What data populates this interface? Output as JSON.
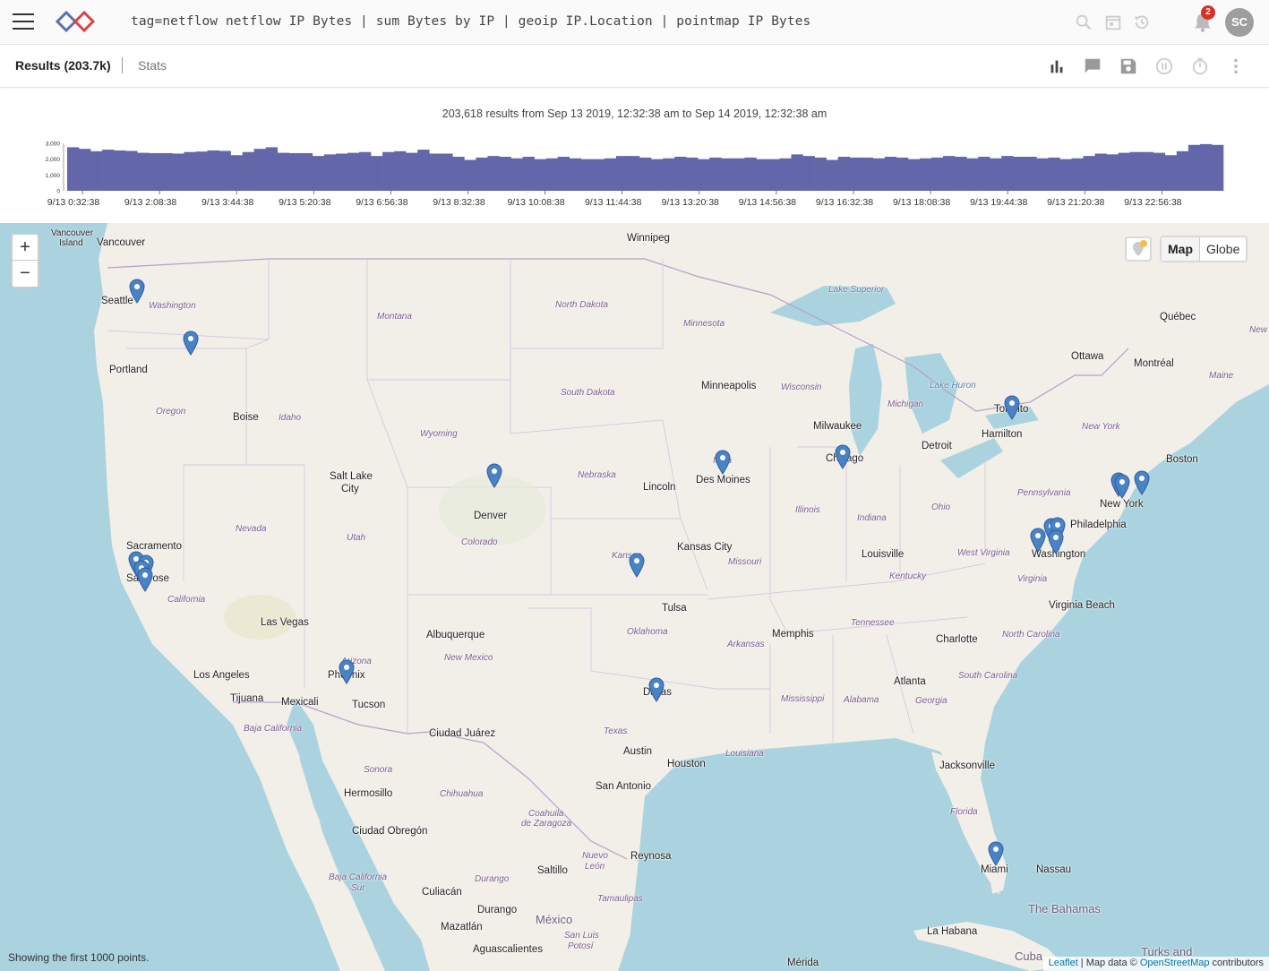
{
  "header": {
    "query": "tag=netflow netflow IP Bytes | sum Bytes by IP | geoip IP.Location | pointmap IP Bytes",
    "notification_count": "2",
    "avatar_initials": "SC",
    "icons": [
      "menu-icon",
      "logo",
      "search-icon",
      "calendar-icon",
      "history-icon",
      "bell-icon"
    ]
  },
  "tabs": {
    "results": "Results (203.7k)",
    "stats": "Stats"
  },
  "toolbar_icons": [
    "bar-chart-icon",
    "chat-icon",
    "save-icon",
    "pause-icon",
    "timer-icon",
    "more-vert-icon"
  ],
  "histogram": {
    "caption": "203,618 results from Sep 13 2019, 12:32:38 am to Sep 14 2019, 12:32:38 am",
    "bar_color": "#6366a8"
  },
  "chart_data": {
    "type": "bar",
    "y_ticks": [
      "3,000",
      "2,000",
      "1,000",
      "0"
    ],
    "ylim": [
      0,
      3000
    ],
    "x_ticks": [
      "9/13 0:32:38",
      "9/13 2:08:38",
      "9/13 3:44:38",
      "9/13 5:20:38",
      "9/13 6:56:38",
      "9/13 8:32:38",
      "9/13 10:08:38",
      "9/13 11:44:38",
      "9/13 13:20:38",
      "9/13 14:56:38",
      "9/13 16:32:38",
      "9/13 18:08:38",
      "9/13 19:44:38",
      "9/13 21:20:38",
      "9/13 22:56:38"
    ],
    "values": [
      2750,
      2650,
      2500,
      2600,
      2550,
      2520,
      2400,
      2380,
      2380,
      2350,
      2450,
      2480,
      2550,
      2520,
      2250,
      2450,
      2650,
      2750,
      2400,
      2380,
      2380,
      2200,
      2300,
      2350,
      2400,
      2450,
      2200,
      2450,
      2500,
      2400,
      2600,
      2350,
      2350,
      2150,
      1950,
      2100,
      2200,
      2150,
      2050,
      2150,
      2000,
      2050,
      2150,
      2050,
      2000,
      2000,
      2050,
      2200,
      2200,
      2100,
      2000,
      2050,
      2150,
      2100,
      2000,
      2100,
      2050,
      2050,
      2100,
      2000,
      2000,
      2050,
      2300,
      2200,
      2100,
      1950,
      2150,
      2100,
      2100,
      2050,
      2150,
      2100,
      2000,
      2050,
      2100,
      2200,
      2150,
      2050,
      2150,
      2050,
      2200,
      2150,
      2150,
      2050,
      2100,
      2000,
      2050,
      2200,
      2350,
      2300,
      2400,
      2450,
      2450,
      2400,
      2250,
      2500,
      2900,
      2950,
      2900
    ]
  },
  "map": {
    "mode_options": [
      "Map",
      "Globe"
    ],
    "active_mode": "Map",
    "zoom_in": "+",
    "zoom_out": "−",
    "status": "Showing the first 1000 points.",
    "attribution_leaflet": "Leaflet",
    "attribution_mid": " | Map data © ",
    "attribution_osm": "OpenStreetMap",
    "attribution_end": " contributors",
    "pin_color": "#4a82c6",
    "labels": {
      "vancouver_island": "Vancouver",
      "vancouver_island2": "Island",
      "vancouver": "Vancouver",
      "winnipeg": "Winnipeg",
      "seattle": "Seattle",
      "washington_state": "Washington",
      "portland": "Portland",
      "montana": "Montana",
      "north_dakota": "North Dakota",
      "minnesota": "Minnesota",
      "lake_superior": "Lake Superior",
      "quebec": "Québec",
      "new": "New",
      "ottawa": "Ottawa",
      "montreal": "Montréal",
      "maine": "Maine",
      "oregon": "Oregon",
      "boise": "Boise",
      "idaho": "Idaho",
      "south_dakota": "South Dakota",
      "minneapolis": "Minneapolis",
      "wisconsin": "Wisconsin",
      "lake_huron": "Lake Huron",
      "michigan": "Michigan",
      "toronto": "Toronto",
      "hamilton": "Hamilton",
      "new_york_state": "New York",
      "wyoming": "Wyoming",
      "milwaukee": "Milwaukee",
      "detroit": "Detroit",
      "boston": "Boston",
      "salt_lake": "Salt Lake",
      "salt_lake2": "City",
      "nebraska": "Nebraska",
      "iowa": "Iowa",
      "des_moines": "Des Moines",
      "chicago": "Chicago",
      "lincoln": "Lincoln",
      "pennsylvania": "Pennsylvania",
      "new_york": "New York",
      "denver": "Denver",
      "illinois": "Illinois",
      "indiana": "Indiana",
      "ohio": "Ohio",
      "philadelphia": "Philadelphia",
      "sacramento": "Sacramento",
      "nevada": "Nevada",
      "utah": "Utah",
      "colorado": "Colorado",
      "kansas_city": "Kansas City",
      "kansas": "Kansas",
      "missouri": "Missouri",
      "louisville": "Louisville",
      "west_virginia": "West Virginia",
      "washington_dc": "Washington",
      "san_jose": "San Jose",
      "kentucky": "Kentucky",
      "virginia": "Virginia",
      "california": "California",
      "tulsa": "Tulsa",
      "virginia_beach": "Virginia Beach",
      "las_vegas": "Las Vegas",
      "tennessee": "Tennessee",
      "albuquerque": "Albuquerque",
      "oklahoma": "Oklahoma",
      "memphis": "Memphis",
      "charlotte": "Charlotte",
      "north_carolina": "North Carolina",
      "arkansas": "Arkansas",
      "arizona": "Arizona",
      "new_mexico": "New Mexico",
      "los_angeles": "Los Angeles",
      "phoenix": "Phoenix",
      "south_carolina": "South Carolina",
      "atlanta": "Atlanta",
      "tijuana": "Tijuana",
      "mexicali": "Mexicali",
      "tucson": "Tucson",
      "dallas": "Dallas",
      "mississippi": "Mississippi",
      "alabama": "Alabama",
      "georgia": "Georgia",
      "baja_california": "Baja California",
      "ciudad_juarez": "Ciudad Juárez",
      "texas": "Texas",
      "austin": "Austin",
      "louisiana": "Louisiana",
      "houston": "Houston",
      "jacksonville": "Jacksonville",
      "sonora": "Sonora",
      "san_antonio": "San Antonio",
      "hermosillo": "Hermosillo",
      "chihuahua": "Chihuahua",
      "florida": "Florida",
      "coahuila": "Coahuila",
      "coahuila2": "de Zaragoza",
      "ciudad_obregon": "Ciudad Obregón",
      "nuevo": "Nuevo",
      "leon": "León",
      "reynosa": "Reynosa",
      "miami": "Miami",
      "nassau": "Nassau",
      "baja_california_sur": "Baja California",
      "baja_california_sur2": "Sur",
      "saltillo": "Saltillo",
      "durango_state": "Durango",
      "culiacan": "Culiacán",
      "tamaulipas": "Tamaulipas",
      "durango": "Durango",
      "the_bahamas": "The Bahamas",
      "mexico": "México",
      "mazatlan": "Mazatlán",
      "la_habana": "La Habana",
      "san_luis": "San Luis",
      "potosi": "Potosí",
      "aguascalientes": "Aguascalientes",
      "cuba": "Cuba",
      "turks": "Turks and",
      "merida": "Mérida"
    }
  }
}
